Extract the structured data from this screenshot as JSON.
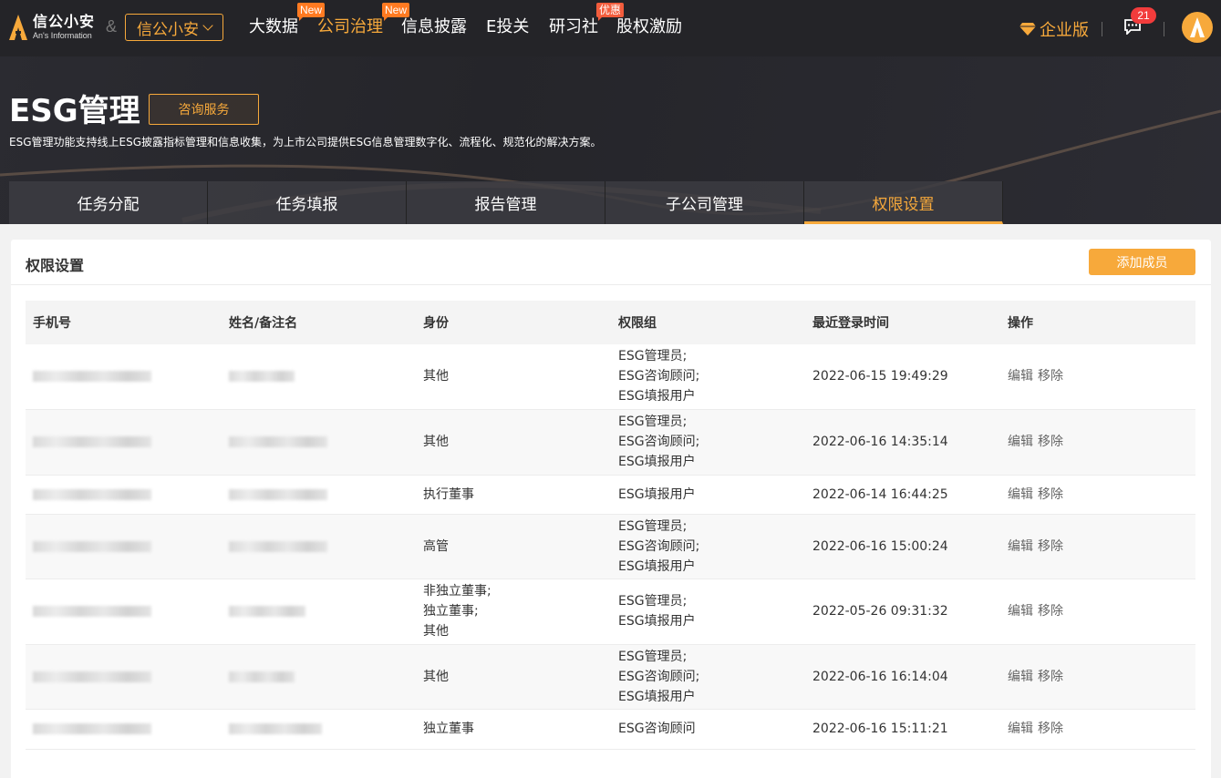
{
  "topnav": {
    "logo_title": "信公小安",
    "logo_sub": "An's Information",
    "amp": "&",
    "product_select": "信公小安",
    "items": [
      {
        "label": "大数据",
        "badge": ""
      },
      {
        "label": "公司治理",
        "badge": "New"
      },
      {
        "label": "信息披露",
        "badge": "New"
      },
      {
        "label": "E投关",
        "badge": ""
      },
      {
        "label": "研习社",
        "badge": "优惠"
      },
      {
        "label": "股权激励",
        "badge": ""
      }
    ],
    "enterprise_label": "企业版",
    "message_count": "21",
    "colors": {
      "accent": "#f7a93b",
      "bg": "#242428"
    }
  },
  "hero": {
    "title": "ESG管理",
    "consult_button": "咨询服务",
    "description": "ESG管理功能支持线上ESG披露指标管理和信息收集，为上市公司提供ESG信息管理数字化、流程化、规范化的解决方案。",
    "tabs": [
      "任务分配",
      "任务填报",
      "报告管理",
      "子公司管理",
      "权限设置"
    ],
    "active_tab": "权限设置"
  },
  "panel": {
    "title": "权限设置",
    "add_button": "添加成员",
    "columns": [
      "手机号",
      "姓名/备注名",
      "身份",
      "权限组",
      "最近登录时间",
      "操作"
    ],
    "rows": [
      {
        "identity": [
          "其他"
        ],
        "perm": [
          "ESG管理员;",
          "ESG咨询顾问;",
          "ESG填报用户"
        ],
        "time": "2022-06-15 19:49:29"
      },
      {
        "identity": [
          "其他"
        ],
        "perm": [
          "ESG管理员;",
          "ESG咨询顾问;",
          "ESG填报用户"
        ],
        "time": "2022-06-16 14:35:14"
      },
      {
        "identity": [
          "执行董事"
        ],
        "perm": [
          "ESG填报用户"
        ],
        "time": "2022-06-14 16:44:25"
      },
      {
        "identity": [
          "高管"
        ],
        "perm": [
          "ESG管理员;",
          "ESG咨询顾问;",
          "ESG填报用户"
        ],
        "time": "2022-06-16 15:00:24"
      },
      {
        "identity": [
          "非独立董事;",
          "独立董事;",
          "其他"
        ],
        "perm": [
          "ESG管理员;",
          "ESG填报用户"
        ],
        "time": "2022-05-26 09:31:32"
      },
      {
        "identity": [
          "其他"
        ],
        "perm": [
          "ESG管理员;",
          "ESG咨询顾问;",
          "ESG填报用户"
        ],
        "time": "2022-06-16 16:14:04"
      },
      {
        "identity": [
          "独立董事"
        ],
        "perm": [
          "ESG咨询顾问"
        ],
        "time": "2022-06-16 15:11:21"
      }
    ],
    "op_edit": "编辑",
    "op_remove": "移除"
  }
}
